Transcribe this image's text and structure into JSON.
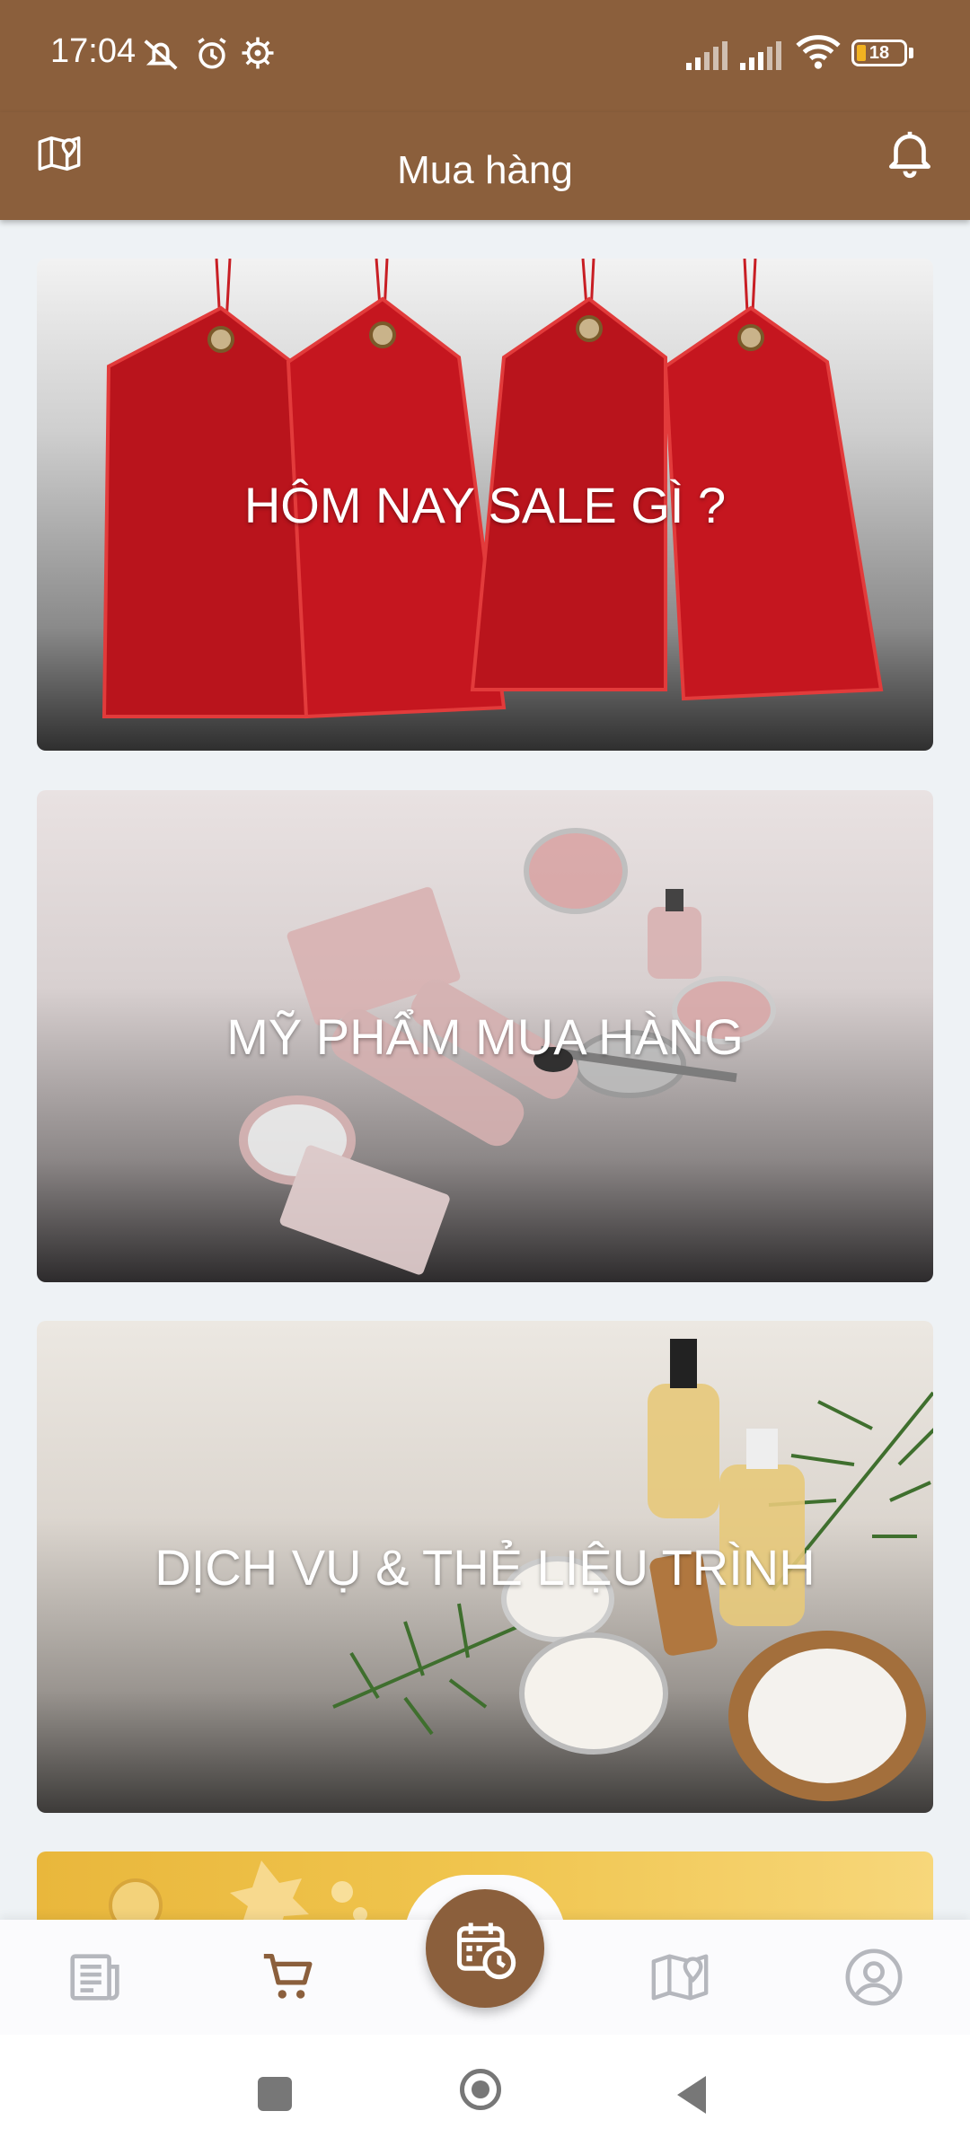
{
  "status_bar": {
    "time": "17:04",
    "battery": "18",
    "icons": [
      "mute-icon",
      "alarm-icon",
      "settings-icon",
      "signal-icon",
      "signal-icon",
      "wifi-icon",
      "battery-icon"
    ]
  },
  "header": {
    "title": "Mua hàng",
    "left_icon": "map-pin-icon",
    "right_icon": "bell-icon"
  },
  "cards": [
    {
      "label": "HÔM NAY SALE GÌ ?"
    },
    {
      "label": "MỸ PHẨM MUA HÀNG"
    },
    {
      "label": "DỊCH VỤ & THẺ LIỆU TRÌNH"
    }
  ],
  "bottom_nav": {
    "items": [
      "news-icon",
      "cart-icon",
      "calendar-clock-icon",
      "map-pin-icon",
      "profile-icon"
    ],
    "active": "cart-icon",
    "accent": "#8b5f3c"
  },
  "colors": {
    "brand": "#8b5f3c",
    "background": "#eef2f5",
    "nav_inactive": "#b5b7bd"
  }
}
